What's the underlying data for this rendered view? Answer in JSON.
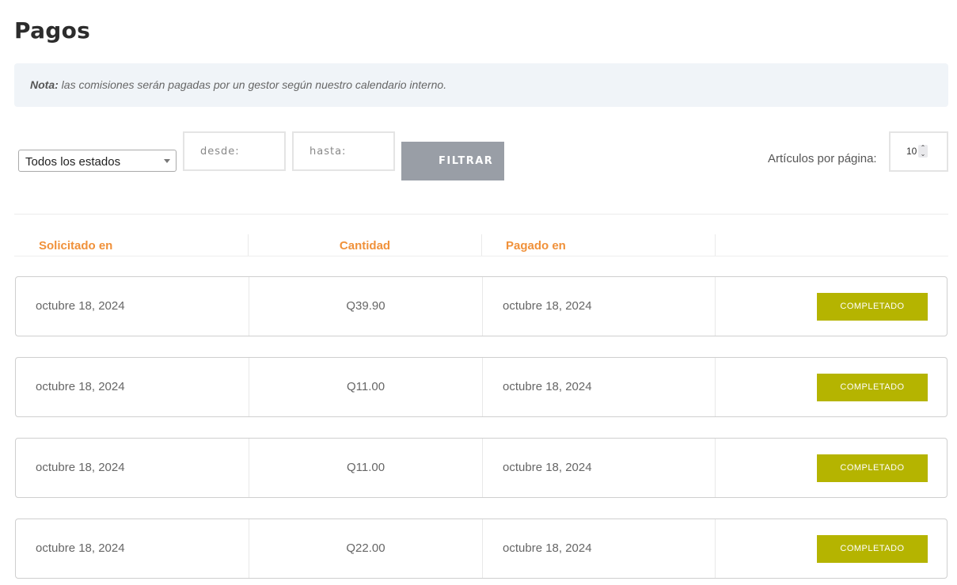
{
  "page": {
    "title": "Pagos"
  },
  "note": {
    "label": "Nota:",
    "text": "las comisiones serán pagadas por un gestor según nuestro calendario interno."
  },
  "filters": {
    "status_selected": "Todos los estados",
    "from_placeholder": "desde:",
    "to_placeholder": "hasta:",
    "filter_button": "FILTRAR",
    "per_page_label": "Artículos por página:",
    "per_page_value": "10"
  },
  "table": {
    "headers": [
      "Solicitado en",
      "Cantidad",
      "Pagado en",
      ""
    ],
    "rows": [
      {
        "requested": "octubre 18, 2024",
        "amount": "Q39.90",
        "paid": "octubre 18, 2024",
        "status": "COMPLETADO"
      },
      {
        "requested": "octubre 18, 2024",
        "amount": "Q11.00",
        "paid": "octubre 18, 2024",
        "status": "COMPLETADO"
      },
      {
        "requested": "octubre 18, 2024",
        "amount": "Q11.00",
        "paid": "octubre 18, 2024",
        "status": "COMPLETADO"
      },
      {
        "requested": "octubre 18, 2024",
        "amount": "Q22.00",
        "paid": "octubre 18, 2024",
        "status": "COMPLETADO"
      }
    ]
  },
  "colors": {
    "header_accent": "#f0913a",
    "status_badge": "#b5b400",
    "filter_button": "#999ea6",
    "note_background": "#f0f4f8"
  }
}
